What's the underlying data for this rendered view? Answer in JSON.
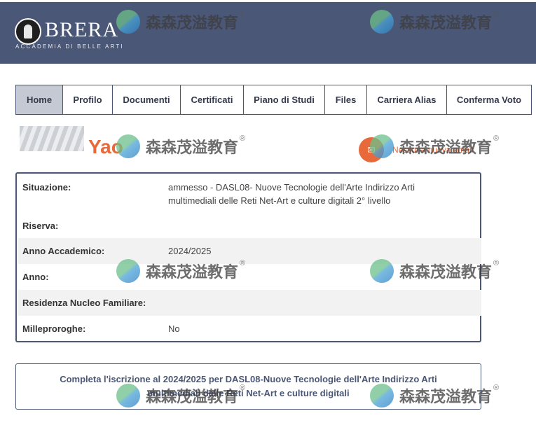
{
  "header": {
    "logo_word": "BRERA",
    "logo_sub": "ACCADEMIA DI BELLE ARTI"
  },
  "nav": {
    "tabs": [
      {
        "label": "Home",
        "active": true
      },
      {
        "label": "Profilo"
      },
      {
        "label": "Documenti"
      },
      {
        "label": "Certificati"
      },
      {
        "label": "Piano di Studi"
      },
      {
        "label": "Files"
      },
      {
        "label": "Carriera Alias"
      },
      {
        "label": "Conferma Voto"
      }
    ]
  },
  "notice": {
    "brand_text": "Yao",
    "mail_text": "Nessuna nuova email",
    "mail_icon": "envelope-icon"
  },
  "info": {
    "rows": [
      {
        "label": "Situazione:",
        "value": "ammesso - DASL08- Nuove Tecnologie dell'Arte Indirizzo Arti multimediali delle Reti Net-Art e culture digitali 2° livello"
      },
      {
        "label": "Riserva:",
        "value": ""
      },
      {
        "label": "Anno Accademico:",
        "value": "2024/2025"
      },
      {
        "label": "Anno:",
        "value": ""
      },
      {
        "label": "Residenza Nucleo Familiare:",
        "value": ""
      },
      {
        "label": "Milleproroghe:",
        "value": "No"
      }
    ]
  },
  "action": {
    "label": "Completa l'iscrizione al 2024/2025 per DASL08-Nuove Tecnologie dell'Arte Indirizzo Arti multimediali delle Reti Net-Art e culture digitali"
  },
  "watermark": {
    "text": "森森茂溢教育",
    "reg": "®"
  },
  "colors": {
    "header_bg": "#4a5777",
    "accent_orange": "#e8693a",
    "tab_active_bg": "#c4c9d4"
  }
}
